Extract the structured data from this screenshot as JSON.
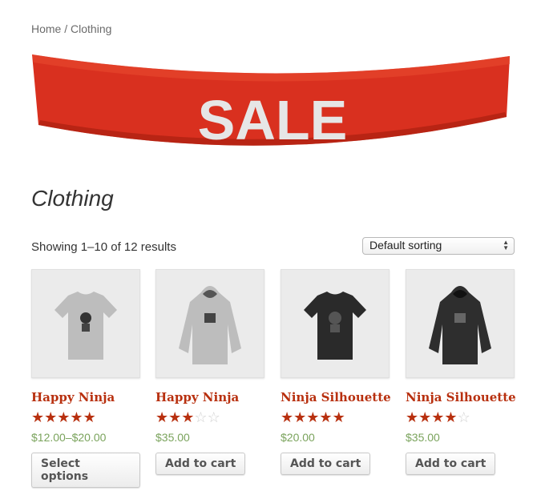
{
  "breadcrumb": {
    "home": "Home",
    "separator": " / ",
    "current": "Clothing"
  },
  "banner": {
    "text": "SALE",
    "color": "#d9301f",
    "text_color": "#e6e6e6"
  },
  "page": {
    "title": "Clothing"
  },
  "shop": {
    "result_count": "Showing 1–10 of 12 results",
    "sort_selected": "Default sorting"
  },
  "colors": {
    "product_title": "#b8300f",
    "price": "#7aa35c",
    "star_filled": "#b8300f",
    "star_empty": "#d0d0d0"
  },
  "products": [
    {
      "name": "Happy Ninja",
      "rating": 5,
      "price": "$12.00–$20.00",
      "button": "Select options",
      "image_icon": "grey-tshirt-icon"
    },
    {
      "name": "Happy Ninja",
      "rating": 3,
      "price": "$35.00",
      "button": "Add to cart",
      "image_icon": "grey-hoodie-icon"
    },
    {
      "name": "Ninja Silhouette",
      "rating": 5,
      "price": "$20.00",
      "button": "Add to cart",
      "image_icon": "black-tshirt-icon"
    },
    {
      "name": "Ninja Silhouette",
      "rating": 4,
      "price": "$35.00",
      "button": "Add to cart",
      "image_icon": "black-hoodie-icon"
    }
  ]
}
